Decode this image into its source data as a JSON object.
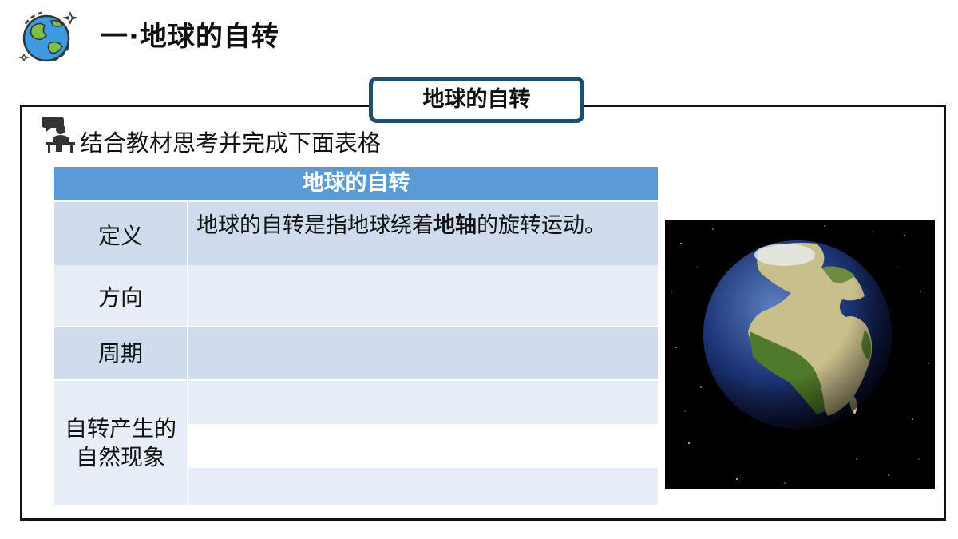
{
  "header": {
    "title": "一·地球的自转"
  },
  "tab": {
    "label": "地球的自转"
  },
  "instruction": "结合教材思考并完成下面表格",
  "table": {
    "title": "地球的自转",
    "rows": [
      {
        "label": "定义",
        "value_prefix": "地球的自转是指地球绕着",
        "value_bold": "地轴",
        "value_suffix": "的旋转运动。"
      },
      {
        "label": "方向",
        "value": ""
      },
      {
        "label": "周期",
        "value": ""
      },
      {
        "label": "自转产生的\n自然现象",
        "value": ""
      }
    ]
  },
  "icons": [
    "globe-icon",
    "reader-icon",
    "earth-photo"
  ],
  "colors": {
    "header_blue": "#5b9bd5",
    "cell_dark": "#cfdcee",
    "cell_light": "#e8eef7",
    "tab_border": "#1e4e70"
  }
}
